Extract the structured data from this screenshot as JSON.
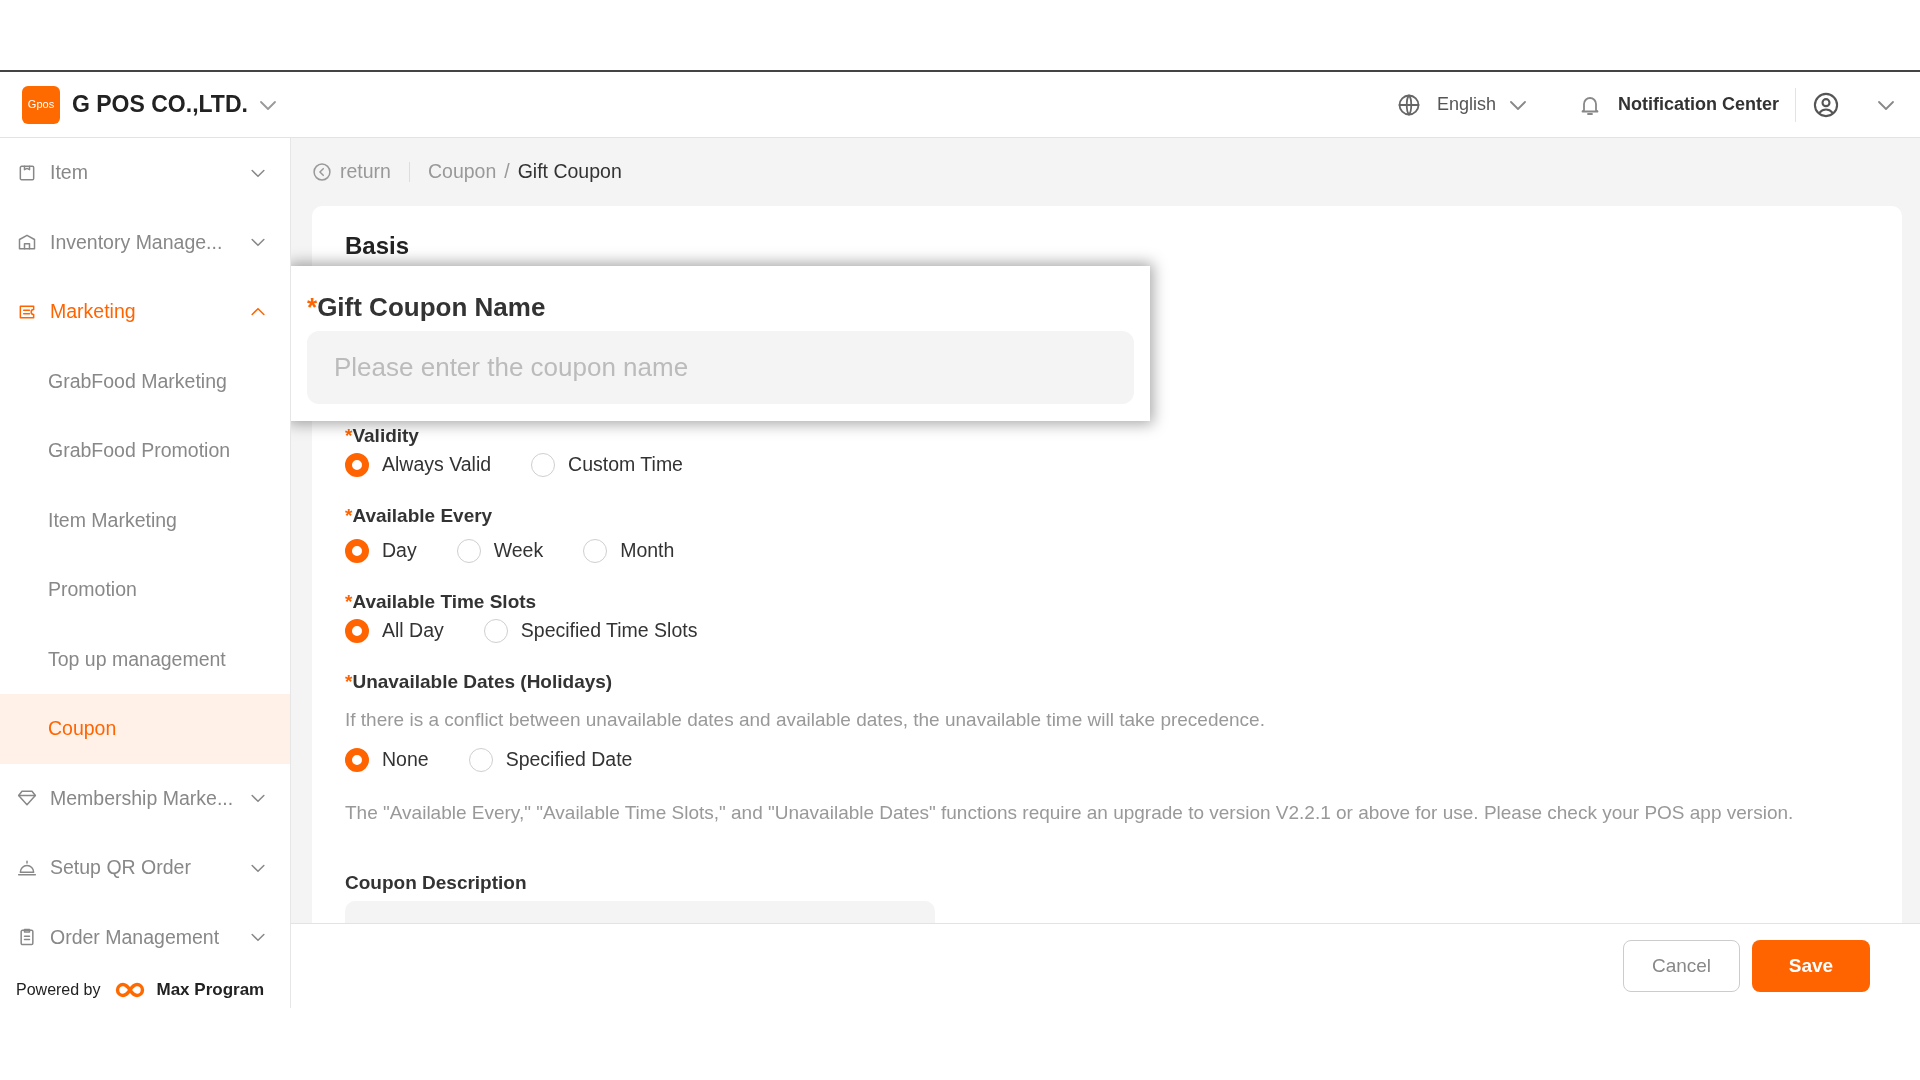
{
  "top_bar": {
    "logo_text": "Gpos",
    "company": "G POS CO.,LTD.",
    "language": "English",
    "notification": "Notification Center"
  },
  "sidebar": {
    "items": [
      {
        "label": "Item",
        "expanded": false,
        "active": false
      },
      {
        "label": "Inventory Manage...",
        "expanded": false,
        "active": false
      },
      {
        "label": "Marketing",
        "expanded": true,
        "active": true,
        "children": [
          {
            "label": "GrabFood Marketing",
            "selected": false
          },
          {
            "label": "GrabFood Promotion",
            "selected": false
          },
          {
            "label": "Item Marketing",
            "selected": false
          },
          {
            "label": "Promotion",
            "selected": false
          },
          {
            "label": "Top up management",
            "selected": false
          },
          {
            "label": "Coupon",
            "selected": true
          }
        ]
      },
      {
        "label": "Membership Marke...",
        "expanded": false,
        "active": false
      },
      {
        "label": "Setup QR Order",
        "expanded": false,
        "active": false
      },
      {
        "label": "Order Management",
        "expanded": false,
        "active": false
      }
    ],
    "powered_by": "Powered by",
    "brand": "Max Program"
  },
  "breadcrumb": {
    "back": "return",
    "separator": "/",
    "items": [
      "Coupon",
      "Gift Coupon"
    ]
  },
  "form": {
    "section": "Basis",
    "name_field": {
      "mark": "*",
      "label": "Gift Coupon Name",
      "placeholder": "Please enter the coupon name"
    },
    "groups": [
      {
        "mark": "*",
        "label": "Validity",
        "options": [
          {
            "label": "Always Valid",
            "selected": true
          },
          {
            "label": "Custom Time",
            "selected": false
          }
        ]
      },
      {
        "mark": "*",
        "label": "Available Every",
        "options": [
          {
            "label": "Day",
            "selected": true
          },
          {
            "label": "Week",
            "selected": false
          },
          {
            "label": "Month",
            "selected": false
          }
        ]
      },
      {
        "mark": "*",
        "label": "Available Time Slots",
        "options": [
          {
            "label": "All Day",
            "selected": true
          },
          {
            "label": "Specified Time Slots",
            "selected": false
          }
        ]
      },
      {
        "mark": "*",
        "label": "Unavailable Dates (Holidays)",
        "hint": "If there is a conflict between unavailable dates and available dates, the unavailable time will take precedence.",
        "options": [
          {
            "label": "None",
            "selected": true
          },
          {
            "label": "Specified Date",
            "selected": false
          }
        ]
      }
    ],
    "note": "The \"Available Every,\" \"Available Time Slots,\" and \"Unavailable Dates\" functions require an upgrade to version V2.2.1 or above for use. Please check your POS app version.",
    "description": {
      "label": "Coupon Description"
    }
  },
  "footer": {
    "buttons": [
      {
        "label": "Cancel",
        "kind": "secondary"
      },
      {
        "label": "Save",
        "kind": "primary"
      }
    ]
  }
}
